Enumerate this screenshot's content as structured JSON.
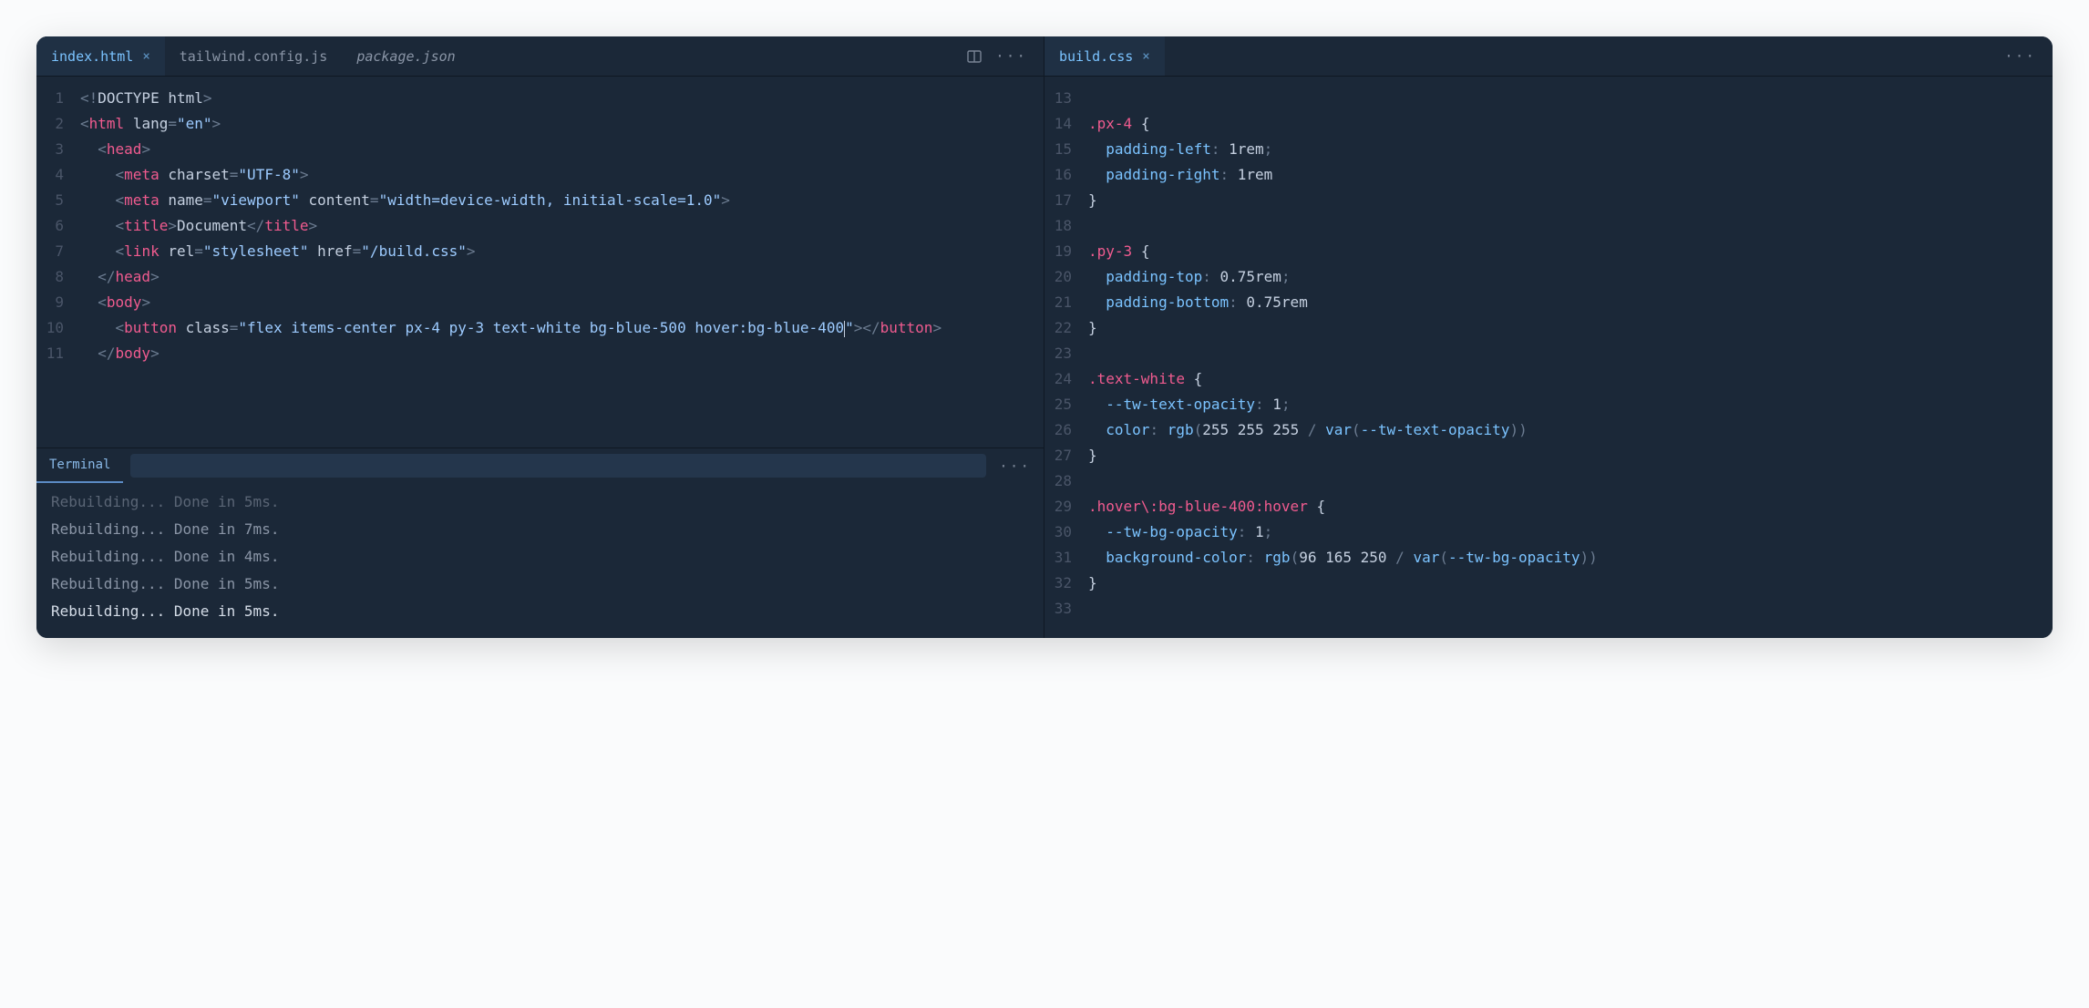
{
  "left": {
    "tabs": [
      {
        "label": "index.html",
        "active": true,
        "closable": true,
        "italic": false
      },
      {
        "label": "tailwind.config.js",
        "active": false,
        "closable": false,
        "italic": false
      },
      {
        "label": "package.json",
        "active": false,
        "closable": false,
        "italic": true
      }
    ],
    "code": [
      {
        "n": "1",
        "tokens": [
          [
            "<!",
            "punct"
          ],
          [
            "DOCTYPE html",
            "doc"
          ],
          [
            ">",
            "punct"
          ]
        ]
      },
      {
        "n": "2",
        "tokens": [
          [
            "<",
            "punct"
          ],
          [
            "html",
            "tag"
          ],
          [
            " ",
            "attr"
          ],
          [
            "lang",
            "attr"
          ],
          [
            "=",
            "punct"
          ],
          [
            "\"en\"",
            "str"
          ],
          [
            ">",
            "punct"
          ]
        ]
      },
      {
        "n": "3",
        "indent": 1,
        "tokens": [
          [
            "<",
            "punct"
          ],
          [
            "head",
            "tag"
          ],
          [
            ">",
            "punct"
          ]
        ]
      },
      {
        "n": "4",
        "indent": 2,
        "tokens": [
          [
            "<",
            "punct"
          ],
          [
            "meta",
            "tag"
          ],
          [
            " ",
            "attr"
          ],
          [
            "charset",
            "attr"
          ],
          [
            "=",
            "punct"
          ],
          [
            "\"UTF-8\"",
            "str"
          ],
          [
            ">",
            "punct"
          ]
        ]
      },
      {
        "n": "5",
        "indent": 2,
        "wrap": true,
        "tokens": [
          [
            "<",
            "punct"
          ],
          [
            "meta",
            "tag"
          ],
          [
            " ",
            "attr"
          ],
          [
            "name",
            "attr"
          ],
          [
            "=",
            "punct"
          ],
          [
            "\"viewport\"",
            "str"
          ],
          [
            " ",
            "attr"
          ],
          [
            "content",
            "attr"
          ],
          [
            "=",
            "punct"
          ],
          [
            "\"width=device-width, initial-scale=1.0\"",
            "str"
          ],
          [
            ">",
            "punct"
          ]
        ]
      },
      {
        "n": "6",
        "indent": 2,
        "tokens": [
          [
            "<",
            "punct"
          ],
          [
            "title",
            "tag"
          ],
          [
            ">",
            "punct"
          ],
          [
            "Document",
            "doc"
          ],
          [
            "</",
            "punct"
          ],
          [
            "title",
            "tag"
          ],
          [
            ">",
            "punct"
          ]
        ]
      },
      {
        "n": "7",
        "indent": 2,
        "tokens": [
          [
            "<",
            "punct"
          ],
          [
            "link",
            "tag"
          ],
          [
            " ",
            "attr"
          ],
          [
            "rel",
            "attr"
          ],
          [
            "=",
            "punct"
          ],
          [
            "\"stylesheet\"",
            "str"
          ],
          [
            " ",
            "attr"
          ],
          [
            "href",
            "attr"
          ],
          [
            "=",
            "punct"
          ],
          [
            "\"/build.css\"",
            "str"
          ],
          [
            ">",
            "punct"
          ]
        ]
      },
      {
        "n": "8",
        "indent": 1,
        "tokens": [
          [
            "</",
            "punct"
          ],
          [
            "head",
            "tag"
          ],
          [
            ">",
            "punct"
          ]
        ]
      },
      {
        "n": "9",
        "indent": 1,
        "tokens": [
          [
            "<",
            "punct"
          ],
          [
            "body",
            "tag"
          ],
          [
            ">",
            "punct"
          ]
        ]
      },
      {
        "n": "10",
        "indent": 2,
        "wrap": true,
        "tokens": [
          [
            "<",
            "punct"
          ],
          [
            "button",
            "tag"
          ],
          [
            " ",
            "attr"
          ],
          [
            "class",
            "attr"
          ],
          [
            "=",
            "punct"
          ],
          [
            "\"flex items-center px-4 py-3 text-white bg-blue-500 hover:bg-blue-400",
            "str"
          ],
          [
            "|",
            "cursor"
          ],
          [
            "\"",
            "str"
          ],
          [
            "></",
            "punct"
          ],
          [
            "button",
            "tag"
          ],
          [
            ">",
            "punct"
          ]
        ]
      },
      {
        "n": "11",
        "indent": 1,
        "tokens": [
          [
            "</",
            "punct"
          ],
          [
            "body",
            "tag"
          ],
          [
            ">",
            "punct"
          ]
        ]
      }
    ]
  },
  "right": {
    "tabs": [
      {
        "label": "build.css",
        "active": true,
        "closable": true,
        "italic": false
      }
    ],
    "code": [
      {
        "n": "13",
        "tokens": []
      },
      {
        "n": "14",
        "tokens": [
          [
            ".px-4",
            "sel"
          ],
          [
            " ",
            "attr"
          ],
          [
            "{",
            "brace"
          ]
        ]
      },
      {
        "n": "15",
        "indent": 1,
        "tokens": [
          [
            "padding-left",
            "prop"
          ],
          [
            ": ",
            "punct"
          ],
          [
            "1rem",
            "val"
          ],
          [
            ";",
            "punct"
          ]
        ]
      },
      {
        "n": "16",
        "indent": 1,
        "tokens": [
          [
            "padding-right",
            "prop"
          ],
          [
            ": ",
            "punct"
          ],
          [
            "1rem",
            "val"
          ]
        ]
      },
      {
        "n": "17",
        "tokens": [
          [
            "}",
            "brace"
          ]
        ]
      },
      {
        "n": "18",
        "tokens": []
      },
      {
        "n": "19",
        "tokens": [
          [
            ".py-3",
            "sel"
          ],
          [
            " ",
            "attr"
          ],
          [
            "{",
            "brace"
          ]
        ]
      },
      {
        "n": "20",
        "indent": 1,
        "tokens": [
          [
            "padding-top",
            "prop"
          ],
          [
            ": ",
            "punct"
          ],
          [
            "0.75rem",
            "val"
          ],
          [
            ";",
            "punct"
          ]
        ]
      },
      {
        "n": "21",
        "indent": 1,
        "tokens": [
          [
            "padding-bottom",
            "prop"
          ],
          [
            ": ",
            "punct"
          ],
          [
            "0.75rem",
            "val"
          ]
        ]
      },
      {
        "n": "22",
        "tokens": [
          [
            "}",
            "brace"
          ]
        ]
      },
      {
        "n": "23",
        "tokens": []
      },
      {
        "n": "24",
        "tokens": [
          [
            ".text-white",
            "sel"
          ],
          [
            " ",
            "attr"
          ],
          [
            "{",
            "brace"
          ]
        ]
      },
      {
        "n": "25",
        "indent": 1,
        "tokens": [
          [
            "--tw-text-opacity",
            "prop"
          ],
          [
            ": ",
            "punct"
          ],
          [
            "1",
            "num"
          ],
          [
            ";",
            "punct"
          ]
        ]
      },
      {
        "n": "26",
        "indent": 1,
        "tokens": [
          [
            "color",
            "prop"
          ],
          [
            ": ",
            "punct"
          ],
          [
            "rgb",
            "fn"
          ],
          [
            "(",
            "punct"
          ],
          [
            "255 255 255",
            "num"
          ],
          [
            " / ",
            "punct"
          ],
          [
            "var",
            "fn"
          ],
          [
            "(",
            "punct"
          ],
          [
            "--tw-text-opacity",
            "prop"
          ],
          [
            "))",
            "punct"
          ]
        ]
      },
      {
        "n": "27",
        "tokens": [
          [
            "}",
            "brace"
          ]
        ]
      },
      {
        "n": "28",
        "tokens": []
      },
      {
        "n": "29",
        "tokens": [
          [
            ".hover\\:bg-blue-400:hover",
            "sel"
          ],
          [
            " ",
            "attr"
          ],
          [
            "{",
            "brace"
          ]
        ]
      },
      {
        "n": "30",
        "indent": 1,
        "tokens": [
          [
            "--tw-bg-opacity",
            "prop"
          ],
          [
            ": ",
            "punct"
          ],
          [
            "1",
            "num"
          ],
          [
            ";",
            "punct"
          ]
        ]
      },
      {
        "n": "31",
        "indent": 1,
        "tokens": [
          [
            "background-color",
            "prop"
          ],
          [
            ": ",
            "punct"
          ],
          [
            "rgb",
            "fn"
          ],
          [
            "(",
            "punct"
          ],
          [
            "96 165 250",
            "num"
          ],
          [
            " / ",
            "punct"
          ],
          [
            "var",
            "fn"
          ],
          [
            "(",
            "punct"
          ],
          [
            "--tw-bg-opacity",
            "prop"
          ],
          [
            "))",
            "punct"
          ]
        ]
      },
      {
        "n": "32",
        "tokens": [
          [
            "}",
            "brace"
          ]
        ]
      },
      {
        "n": "33",
        "tokens": []
      }
    ]
  },
  "terminal": {
    "tab_label": "Terminal",
    "lines": [
      {
        "text": "Rebuilding... Done in 5ms.",
        "fresh": false,
        "dim": true
      },
      {
        "text": "Rebuilding... Done in 7ms.",
        "fresh": false,
        "dim": false
      },
      {
        "text": "Rebuilding... Done in 4ms.",
        "fresh": false,
        "dim": false
      },
      {
        "text": "Rebuilding... Done in 5ms.",
        "fresh": false,
        "dim": false
      },
      {
        "text": "Rebuilding... Done in 5ms.",
        "fresh": true,
        "dim": false
      }
    ]
  }
}
